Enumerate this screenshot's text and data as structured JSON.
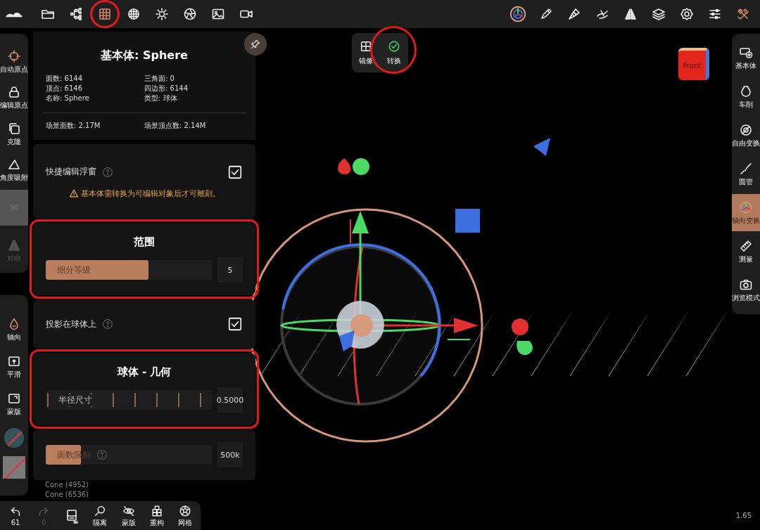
{
  "top_bar": {
    "left_tools": [
      {
        "selected": false,
        "highlighted": false
      },
      {
        "selected": false,
        "highlighted": false
      },
      {
        "selected": false,
        "highlighted": false
      },
      {
        "selected": true,
        "highlighted": true
      },
      {
        "selected": false,
        "highlighted": false
      },
      {
        "selected": false,
        "highlighted": false
      },
      {
        "selected": false,
        "highlighted": false
      },
      {
        "selected": false,
        "highlighted": false
      },
      {
        "selected": false,
        "highlighted": false
      }
    ]
  },
  "floating_buttons": [
    {
      "label": "镜像",
      "highlighted": false
    },
    {
      "label": "转换",
      "highlighted": true
    }
  ],
  "left_toolbar": {
    "groups": [
      [
        {
          "kind": "tool",
          "label": "自动原点",
          "selected": true,
          "disabled": false
        },
        {
          "kind": "tool",
          "label": "编辑原点",
          "selected": false,
          "disabled": false
        },
        {
          "kind": "tool",
          "label": "克隆",
          "selected": false,
          "disabled": false
        },
        {
          "kind": "tool",
          "label": "角度吸附",
          "selected": false,
          "disabled": false
        },
        {
          "kind": "field",
          "label": "90"
        },
        {
          "kind": "tool",
          "label": "对称",
          "selected": false,
          "disabled": true
        }
      ],
      [
        {
          "kind": "tool",
          "label": "轴向",
          "selected": true,
          "disabled": false
        },
        {
          "kind": "tool",
          "label": "平滑",
          "selected": false,
          "disabled": false
        },
        {
          "kind": "tool",
          "label": "蒙版",
          "selected": false,
          "disabled": false
        },
        {
          "kind": "color",
          "color": "#34545a"
        },
        {
          "kind": "material"
        }
      ]
    ]
  },
  "panel": {
    "title": "基本体: Sphere",
    "stats": [
      "面数: 6144",
      "三角面: 0",
      "顶点: 6146",
      "四边形: 6144",
      "名称: Sphere",
      "类型: 球体"
    ],
    "scene_stats": [
      "场景面数: 2.17M",
      "场景顶点数: 2.14M"
    ],
    "sections": [
      {
        "kind": "checkbox",
        "label": "快捷编辑浮窗",
        "help": true,
        "checked": true,
        "warning": "基本体需转换为可编辑对象后才可雕刻。",
        "highlighted": false
      },
      {
        "kind": "slider",
        "title": "范围",
        "label": "细分等级",
        "level": 0.62,
        "value": "5",
        "highlighted": true
      },
      {
        "kind": "checkbox",
        "label": "投影在球体上",
        "help": true,
        "checked": true,
        "highlighted": false
      },
      {
        "kind": "ruler",
        "title": "球体 - 几何",
        "label": "半径尺寸",
        "value": "0.5000",
        "highlighted": true
      },
      {
        "kind": "slider",
        "label": "面数限制",
        "help": true,
        "level": 0.21,
        "value": "500k",
        "highlighted": false
      }
    ]
  },
  "scene_list": [
    "Cone (4952)",
    "Cone (6536)"
  ],
  "view_cube": {
    "label": "Front"
  },
  "right_toolbar": [
    {
      "label": "基本体",
      "selected": false
    },
    {
      "label": "车削",
      "selected": false
    },
    {
      "label": "自由变换",
      "selected": false
    },
    {
      "label": "圆管",
      "selected": false
    },
    {
      "label": "轴向变换",
      "selected": true
    },
    {
      "label": "测量",
      "selected": false
    },
    {
      "label": "浏览模式",
      "selected": false
    }
  ],
  "bottom_bar": {
    "undo": "61",
    "redo": {
      "count": "0",
      "disabled": true
    },
    "tools": [
      "隔离",
      "蒙版",
      "重构",
      "网格"
    ]
  },
  "version": "1.65"
}
